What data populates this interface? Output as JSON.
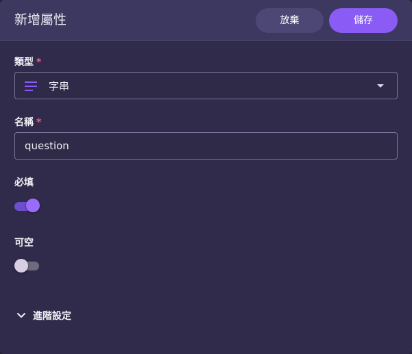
{
  "dialog": {
    "title": "新增屬性",
    "discard_label": "放棄",
    "save_label": "儲存"
  },
  "fields": {
    "type": {
      "label": "類型",
      "required_mark": "*",
      "value": "字串",
      "icon": "text-lines-icon"
    },
    "name": {
      "label": "名稱",
      "required_mark": "*",
      "value": "question"
    },
    "required": {
      "label": "必填",
      "enabled": true
    },
    "nullable": {
      "label": "可空",
      "enabled": false
    }
  },
  "advanced": {
    "label": "進階設定",
    "expanded": false
  },
  "colors": {
    "accent": "#8a5cf5",
    "required_mark": "#ea5b8e",
    "background": "#302b4a"
  }
}
